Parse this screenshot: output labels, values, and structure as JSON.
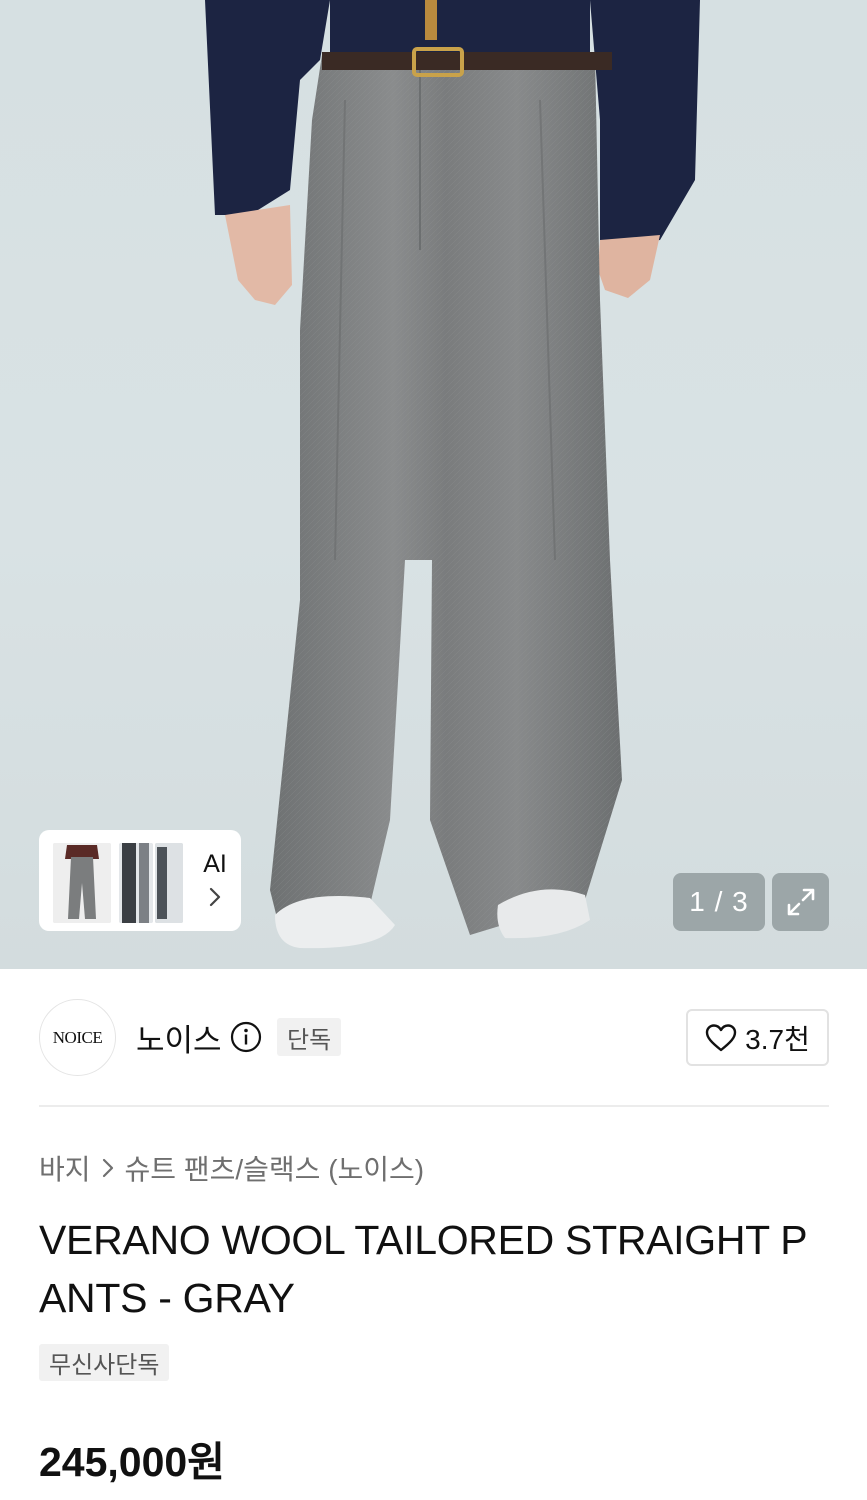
{
  "gallery": {
    "counter": "1 / 3",
    "ai_label": "AI",
    "icons": {
      "expand": "expand-icon",
      "ai_arrow": "chevron-right-icon"
    }
  },
  "brand": {
    "logo_text": "NOICE",
    "name": "노이스",
    "badge": "단독",
    "like_count": "3.7천",
    "icons": {
      "info": "info-icon",
      "like": "heart-icon"
    }
  },
  "breadcrumb": {
    "items": [
      "바지",
      "슈트 팬츠/슬랙스 (노이스)"
    ]
  },
  "product": {
    "title": "VERANO WOOL TAILORED STRAIGHT PANTS - GRAY",
    "tag": "무신사단독",
    "price": "245,000원"
  },
  "colors": {
    "backdrop": "#d6e0e2",
    "pants": "#7d7f80",
    "shirt": "#1c2442",
    "overlay": "rgba(110,120,122,0.55)"
  }
}
